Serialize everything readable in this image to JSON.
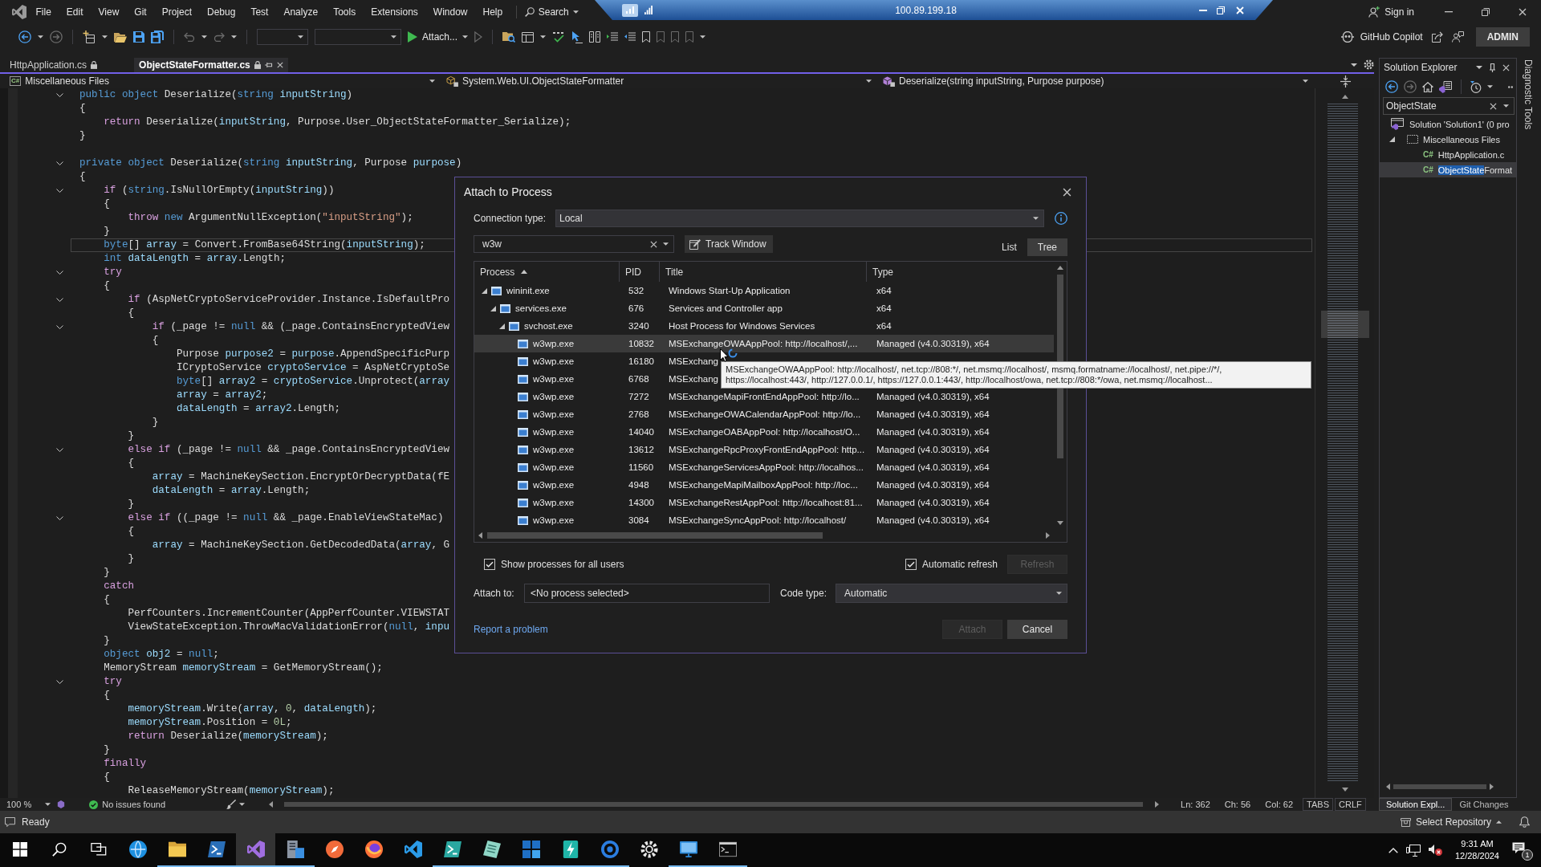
{
  "menu_bar": {
    "items": [
      "File",
      "Edit",
      "View",
      "Git",
      "Project",
      "Debug",
      "Test",
      "Analyze",
      "Tools",
      "Extensions",
      "Window",
      "Help"
    ],
    "search": "Search"
  },
  "remote_session": {
    "address": "100.89.199.18"
  },
  "account": {
    "sign_in": "Sign in"
  },
  "toolbar": {
    "attach": "Attach...",
    "copilot": "GitHub Copilot",
    "user": "ADMIN"
  },
  "tabs": [
    {
      "label": "HttpApplication.cs",
      "selected": false
    },
    {
      "label": "ObjectStateFormatter.cs",
      "selected": true
    }
  ],
  "nav_bar": [
    {
      "kind": "project",
      "badge": "C#",
      "label": "Miscellaneous Files"
    },
    {
      "kind": "class",
      "label": "System.Web.UI.ObjectStateFormatter"
    },
    {
      "kind": "method",
      "label": "Deserialize(string inputString, Purpose purpose)"
    }
  ],
  "code_lines": [
    {
      "spans": [
        {
          "kind": "keyword",
          "text": "public object"
        },
        {
          "kind": "plain",
          "text": " Deserialize("
        },
        {
          "kind": "keyword",
          "text": "string"
        },
        {
          "kind": "variable",
          "text": " inputString"
        },
        {
          "kind": "plain",
          "text": ")"
        }
      ],
      "fold": true,
      "current": false
    },
    {
      "spans": [
        {
          "kind": "plain",
          "text": "{"
        }
      ],
      "fold": false,
      "current": false
    },
    {
      "spans": [
        {
          "kind": "control",
          "text": "    return"
        },
        {
          "kind": "plain",
          "text": " Deserialize("
        },
        {
          "kind": "variable",
          "text": "inputString"
        },
        {
          "kind": "plain",
          "text": ", Purpose.User_ObjectStateFormatter_Serialize);"
        }
      ],
      "fold": false,
      "current": false
    },
    {
      "spans": [
        {
          "kind": "plain",
          "text": "}"
        }
      ],
      "fold": false,
      "current": false
    },
    {
      "fold": false,
      "current": false
    },
    {
      "spans": [
        {
          "kind": "keyword",
          "text": "private object"
        },
        {
          "kind": "plain",
          "text": " Deserialize("
        },
        {
          "kind": "keyword",
          "text": "string"
        },
        {
          "kind": "variable",
          "text": " inputString"
        },
        {
          "kind": "plain",
          "text": ", Purpose"
        },
        {
          "kind": "variable",
          "text": " purpose"
        },
        {
          "kind": "plain",
          "text": ")"
        }
      ],
      "fold": true,
      "current": false
    },
    {
      "spans": [
        {
          "kind": "plain",
          "text": "{"
        }
      ],
      "fold": false,
      "current": false
    },
    {
      "spans": [
        {
          "kind": "control",
          "text": "    if"
        },
        {
          "kind": "plain",
          "text": " ("
        },
        {
          "kind": "keyword",
          "text": "string"
        },
        {
          "kind": "plain",
          "text": ".IsNullOrEmpty("
        },
        {
          "kind": "variable",
          "text": "inputString"
        },
        {
          "kind": "plain",
          "text": "))"
        }
      ],
      "fold": true,
      "current": false
    },
    {
      "spans": [
        {
          "kind": "plain",
          "text": "    {"
        }
      ],
      "fold": false,
      "current": false
    },
    {
      "spans": [
        {
          "kind": "control",
          "text": "        throw"
        },
        {
          "kind": "keyword",
          "text": " new"
        },
        {
          "kind": "plain",
          "text": " ArgumentNullException("
        },
        {
          "kind": "string",
          "text": "\"inputString\""
        },
        {
          "kind": "plain",
          "text": ");"
        }
      ],
      "fold": false,
      "current": false
    },
    {
      "spans": [
        {
          "kind": "plain",
          "text": "    }"
        }
      ],
      "fold": false,
      "current": false
    },
    {
      "spans": [
        {
          "kind": "keyword",
          "text": "    byte"
        },
        {
          "kind": "plain",
          "text": "[]"
        },
        {
          "kind": "variable",
          "text": " array"
        },
        {
          "kind": "plain",
          "text": " = Convert.FromBase64String("
        },
        {
          "kind": "variable",
          "text": "inputString"
        },
        {
          "kind": "plain",
          "text": ");"
        }
      ],
      "fold": false,
      "current": true
    },
    {
      "spans": [
        {
          "kind": "keyword",
          "text": "    int"
        },
        {
          "kind": "variable",
          "text": " dataLength"
        },
        {
          "kind": "plain",
          "text": " ="
        },
        {
          "kind": "variable",
          "text": " array"
        },
        {
          "kind": "plain",
          "text": ".Length;"
        }
      ],
      "fold": false,
      "current": false
    },
    {
      "spans": [
        {
          "kind": "control",
          "text": "    try"
        }
      ],
      "fold": true,
      "current": false
    },
    {
      "spans": [
        {
          "kind": "plain",
          "text": "    {"
        }
      ],
      "fold": false,
      "current": false
    },
    {
      "spans": [
        {
          "kind": "control",
          "text": "        if"
        },
        {
          "kind": "plain",
          "text": " (AspNetCryptoServiceProvider.Instance.IsDefaultPro"
        }
      ],
      "fold": true,
      "current": false
    },
    {
      "spans": [
        {
          "kind": "plain",
          "text": "        {"
        }
      ],
      "fold": false,
      "current": false
    },
    {
      "spans": [
        {
          "kind": "control",
          "text": "            if"
        },
        {
          "kind": "plain",
          "text": " (_page !="
        },
        {
          "kind": "keyword",
          "text": " null"
        },
        {
          "kind": "plain",
          "text": " && (_page.ContainsEncryptedView"
        }
      ],
      "fold": true,
      "current": false
    },
    {
      "spans": [
        {
          "kind": "plain",
          "text": "            {"
        }
      ],
      "fold": false,
      "current": false
    },
    {
      "spans": [
        {
          "kind": "plain",
          "text": "                Purpose"
        },
        {
          "kind": "variable",
          "text": " purpose2"
        },
        {
          "kind": "plain",
          "text": " ="
        },
        {
          "kind": "variable",
          "text": " purpose"
        },
        {
          "kind": "plain",
          "text": ".AppendSpecificPurp"
        }
      ],
      "fold": false,
      "current": false
    },
    {
      "spans": [
        {
          "kind": "plain",
          "text": "                ICryptoService"
        },
        {
          "kind": "variable",
          "text": " cryptoService"
        },
        {
          "kind": "plain",
          "text": " = AspNetCryptoSe"
        }
      ],
      "fold": false,
      "current": false
    },
    {
      "spans": [
        {
          "kind": "keyword",
          "text": "                byte"
        },
        {
          "kind": "plain",
          "text": "[]"
        },
        {
          "kind": "variable",
          "text": " array2"
        },
        {
          "kind": "plain",
          "text": " ="
        },
        {
          "kind": "variable",
          "text": " cryptoService"
        },
        {
          "kind": "plain",
          "text": ".Unprotect("
        },
        {
          "kind": "variable",
          "text": "array"
        }
      ],
      "fold": false,
      "current": false
    },
    {
      "spans": [
        {
          "kind": "variable",
          "text": "                array"
        },
        {
          "kind": "plain",
          "text": " ="
        },
        {
          "kind": "variable",
          "text": " array2"
        },
        {
          "kind": "plain",
          "text": ";"
        }
      ],
      "fold": false,
      "current": false
    },
    {
      "spans": [
        {
          "kind": "variable",
          "text": "                dataLength"
        },
        {
          "kind": "plain",
          "text": " ="
        },
        {
          "kind": "variable",
          "text": " array2"
        },
        {
          "kind": "plain",
          "text": ".Length;"
        }
      ],
      "fold": false,
      "current": false
    },
    {
      "spans": [
        {
          "kind": "plain",
          "text": "            }"
        }
      ],
      "fold": false,
      "current": false
    },
    {
      "spans": [
        {
          "kind": "plain",
          "text": "        }"
        }
      ],
      "fold": false,
      "current": false
    },
    {
      "spans": [
        {
          "kind": "control",
          "text": "        else if"
        },
        {
          "kind": "plain",
          "text": " (_page !="
        },
        {
          "kind": "keyword",
          "text": " null"
        },
        {
          "kind": "plain",
          "text": " && _page.ContainsEncryptedView"
        }
      ],
      "fold": true,
      "current": false
    },
    {
      "spans": [
        {
          "kind": "plain",
          "text": "        {"
        }
      ],
      "fold": false,
      "current": false
    },
    {
      "spans": [
        {
          "kind": "variable",
          "text": "            array"
        },
        {
          "kind": "plain",
          "text": " = MachineKeySection.EncryptOrDecryptData(fE"
        }
      ],
      "fold": false,
      "current": false
    },
    {
      "spans": [
        {
          "kind": "variable",
          "text": "            dataLength"
        },
        {
          "kind": "plain",
          "text": " ="
        },
        {
          "kind": "variable",
          "text": " array"
        },
        {
          "kind": "plain",
          "text": ".Length;"
        }
      ],
      "fold": false,
      "current": false
    },
    {
      "spans": [
        {
          "kind": "plain",
          "text": "        }"
        }
      ],
      "fold": false,
      "current": false
    },
    {
      "spans": [
        {
          "kind": "control",
          "text": "        else if"
        },
        {
          "kind": "plain",
          "text": " ((_page !="
        },
        {
          "kind": "keyword",
          "text": " null"
        },
        {
          "kind": "plain",
          "text": " && _page.EnableViewStateMac)"
        }
      ],
      "fold": true,
      "current": false
    },
    {
      "spans": [
        {
          "kind": "plain",
          "text": "        {"
        }
      ],
      "fold": false,
      "current": false
    },
    {
      "spans": [
        {
          "kind": "variable",
          "text": "            array"
        },
        {
          "kind": "plain",
          "text": " = MachineKeySection.GetDecodedData("
        },
        {
          "kind": "variable",
          "text": "array"
        },
        {
          "kind": "plain",
          "text": ", G"
        }
      ],
      "fold": false,
      "current": false
    },
    {
      "spans": [
        {
          "kind": "plain",
          "text": "        }"
        }
      ],
      "fold": false,
      "current": false
    },
    {
      "spans": [
        {
          "kind": "plain",
          "text": "    }"
        }
      ],
      "fold": false,
      "current": false
    },
    {
      "spans": [
        {
          "kind": "control",
          "text": "    catch"
        }
      ],
      "fold": false,
      "current": false
    },
    {
      "spans": [
        {
          "kind": "plain",
          "text": "    {"
        }
      ],
      "fold": false,
      "current": false
    },
    {
      "spans": [
        {
          "kind": "plain",
          "text": "        PerfCounters.IncrementCounter(AppPerfCounter.VIEWSTAT"
        }
      ],
      "fold": false,
      "current": false
    },
    {
      "spans": [
        {
          "kind": "plain",
          "text": "        ViewStateException.ThrowMacValidationError("
        },
        {
          "kind": "keyword",
          "text": "null"
        },
        {
          "kind": "plain",
          "text": ","
        },
        {
          "kind": "variable",
          "text": " inpu"
        }
      ],
      "fold": false,
      "current": false
    },
    {
      "spans": [
        {
          "kind": "plain",
          "text": "    }"
        }
      ],
      "fold": false,
      "current": false
    },
    {
      "spans": [
        {
          "kind": "keyword",
          "text": "    object"
        },
        {
          "kind": "variable",
          "text": " obj2"
        },
        {
          "kind": "plain",
          "text": " ="
        },
        {
          "kind": "keyword",
          "text": " null"
        },
        {
          "kind": "plain",
          "text": ";"
        }
      ],
      "fold": false,
      "current": false
    },
    {
      "spans": [
        {
          "kind": "plain",
          "text": "    MemoryStream"
        },
        {
          "kind": "variable",
          "text": " memoryStream"
        },
        {
          "kind": "plain",
          "text": " = GetMemoryStream();"
        }
      ],
      "fold": false,
      "current": false
    },
    {
      "spans": [
        {
          "kind": "control",
          "text": "    try"
        }
      ],
      "fold": true,
      "current": false
    },
    {
      "spans": [
        {
          "kind": "plain",
          "text": "    {"
        }
      ],
      "fold": false,
      "current": false
    },
    {
      "spans": [
        {
          "kind": "variable",
          "text": "        memoryStream"
        },
        {
          "kind": "plain",
          "text": ".Write("
        },
        {
          "kind": "variable",
          "text": "array"
        },
        {
          "kind": "plain",
          "text": ","
        },
        {
          "kind": "number",
          "text": " 0"
        },
        {
          "kind": "plain",
          "text": ","
        },
        {
          "kind": "variable",
          "text": " dataLength"
        },
        {
          "kind": "plain",
          "text": ");"
        }
      ],
      "fold": false,
      "current": false
    },
    {
      "spans": [
        {
          "kind": "variable",
          "text": "        memoryStream"
        },
        {
          "kind": "plain",
          "text": ".Position ="
        },
        {
          "kind": "number",
          "text": " 0L"
        },
        {
          "kind": "plain",
          "text": ";"
        }
      ],
      "fold": false,
      "current": false
    },
    {
      "spans": [
        {
          "kind": "control",
          "text": "        return"
        },
        {
          "kind": "plain",
          "text": " Deserialize("
        },
        {
          "kind": "variable",
          "text": "memoryStream"
        },
        {
          "kind": "plain",
          "text": ");"
        }
      ],
      "fold": false,
      "current": false
    },
    {
      "spans": [
        {
          "kind": "plain",
          "text": "    }"
        }
      ],
      "fold": false,
      "current": false
    },
    {
      "spans": [
        {
          "kind": "control",
          "text": "    finally"
        }
      ],
      "fold": false,
      "current": false
    },
    {
      "spans": [
        {
          "kind": "plain",
          "text": "    {"
        }
      ],
      "fold": false,
      "current": false
    },
    {
      "spans": [
        {
          "kind": "plain",
          "text": "        ReleaseMemoryStream("
        },
        {
          "kind": "variable",
          "text": "memoryStream"
        },
        {
          "kind": "plain",
          "text": ");"
        }
      ],
      "fold": false,
      "current": false
    }
  ],
  "editor_status": {
    "zoom": "100 %",
    "issues": "No issues found",
    "line": "Ln: 362",
    "char": "Ch: 56",
    "column": "Col: 62",
    "indent": "TABS",
    "line_ending": "CRLF"
  },
  "dialog": {
    "title": "Attach to Process",
    "connection": {
      "label": "Connection type:",
      "value": "Local"
    },
    "filter": {
      "value": "w3w"
    },
    "track_button": "Track Window",
    "views": [
      {
        "label": "List",
        "selected": false
      },
      {
        "label": "Tree",
        "selected": true
      }
    ],
    "columns": [
      {
        "label": "Process",
        "sorted": true
      },
      {
        "label": "PID",
        "sorted": false
      },
      {
        "label": "Title",
        "sorted": false
      },
      {
        "label": "Type",
        "sorted": false
      }
    ],
    "rows": [
      {
        "process": "wininit.exe",
        "pid": "532",
        "title": "Windows Start-Up Application",
        "type": "x64",
        "expanded": true,
        "hovered": false,
        "children": [
          {
            "process": "services.exe",
            "pid": "676",
            "title": "Services and Controller app",
            "type": "x64",
            "expanded": true,
            "hovered": false,
            "children": [
              {
                "process": "svchost.exe",
                "pid": "3240",
                "title": "Host Process for Windows Services",
                "type": "x64",
                "expanded": true,
                "hovered": false,
                "children": [
                  {
                    "process": "w3wp.exe",
                    "pid": "10832",
                    "title": "MSExchangeOWAAppPool: http://localhost/,...",
                    "type": "Managed (v4.0.30319), x64",
                    "hovered": true
                  },
                  {
                    "process": "w3wp.exe",
                    "pid": "16180",
                    "title": "MSExchang",
                    "hovered": false
                  },
                  {
                    "process": "w3wp.exe",
                    "pid": "6768",
                    "title": "MSExchang",
                    "hovered": false
                  },
                  {
                    "process": "w3wp.exe",
                    "pid": "7272",
                    "title": "MSExchangeMapiFrontEndAppPool: http://lo...",
                    "type": "Managed (v4.0.30319), x64",
                    "hovered": false
                  },
                  {
                    "process": "w3wp.exe",
                    "pid": "2768",
                    "title": "MSExchangeOWACalendarAppPool: http://lo...",
                    "type": "Managed (v4.0.30319), x64",
                    "hovered": false
                  },
                  {
                    "process": "w3wp.exe",
                    "pid": "14040",
                    "title": "MSExchangeOABAppPool: http://localhost/O...",
                    "type": "Managed (v4.0.30319), x64",
                    "hovered": false
                  },
                  {
                    "process": "w3wp.exe",
                    "pid": "13612",
                    "title": "MSExchangeRpcProxyFrontEndAppPool: http...",
                    "type": "Managed (v4.0.30319), x64",
                    "hovered": false
                  },
                  {
                    "process": "w3wp.exe",
                    "pid": "11560",
                    "title": "MSExchangeServicesAppPool: http://localhos...",
                    "type": "Managed (v4.0.30319), x64",
                    "hovered": false
                  },
                  {
                    "process": "w3wp.exe",
                    "pid": "4948",
                    "title": "MSExchangeMapiMailboxAppPool: http://loc...",
                    "type": "Managed (v4.0.30319), x64",
                    "hovered": false
                  },
                  {
                    "process": "w3wp.exe",
                    "pid": "14300",
                    "title": "MSExchangeRestAppPool: http://localhost:81...",
                    "type": "Managed (v4.0.30319), x64",
                    "hovered": false
                  },
                  {
                    "process": "w3wp.exe",
                    "pid": "3084",
                    "title": "MSExchangeSyncAppPool: http://localhost/",
                    "type": "Managed (v4.0.30319), x64",
                    "hovered": false
                  }
                ]
              }
            ]
          }
        ]
      }
    ],
    "tooltip": "MSExchangeOWAAppPool: http://localhost/, net.tcp://808:*/, net.msmq://localhost/, msmq.formatname://localhost/, net.pipe://*/, https://localhost:443/, http://127.0.0.1/, https://127.0.0.1:443/, http://localhost/owa, net.tcp://808:*/owa, net.msmq://localhost...",
    "show_all_users": {
      "label": "Show processes for all users",
      "checked": true
    },
    "auto_refresh": {
      "label": "Automatic refresh",
      "checked": true
    },
    "refresh_button": {
      "label": "Refresh",
      "disabled": true
    },
    "attach_to": {
      "label": "Attach to:",
      "value": "<No process selected>"
    },
    "code_type": {
      "label": "Code type:",
      "value": "Automatic"
    },
    "report_link": "Report a problem",
    "buttons": [
      {
        "label": "Attach",
        "disabled": true
      },
      {
        "label": "Cancel",
        "disabled": false
      }
    ]
  },
  "solution_explorer": {
    "title": "Solution Explorer",
    "search": {
      "value": "ObjectState"
    },
    "tree": [
      {
        "kind": "solution",
        "label": "Solution 'Solution1' (0 pro",
        "selected": false,
        "children": [
          {
            "kind": "folder",
            "label": "Miscellaneous Files",
            "expanded": true,
            "selected": false,
            "children": [
              {
                "kind": "file",
                "badge": "C#",
                "label": "HttpApplication.c",
                "selected": false
              },
              {
                "kind": "file",
                "badge": "C#",
                "match": "ObjectState",
                "label": "Format",
                "selected": true
              }
            ]
          }
        ]
      }
    ]
  },
  "side_tab": "Diagnostic Tools",
  "panel_tabs": [
    {
      "label": "Solution Expl...",
      "selected": true
    },
    {
      "label": "Git Changes",
      "selected": false
    }
  ],
  "status_bar": {
    "state": "Ready",
    "repository": "Select Repository"
  },
  "taskbar": {
    "apps": [
      {
        "kind": "browser",
        "active": false,
        "running": false
      },
      {
        "kind": "folder",
        "active": false,
        "running": true
      },
      {
        "kind": "shell",
        "active": false,
        "running": true
      },
      {
        "kind": "studio",
        "active": true,
        "running": true
      },
      {
        "kind": "server",
        "active": false,
        "running": true
      },
      {
        "kind": "compass",
        "active": false,
        "running": false
      },
      {
        "kind": "fox",
        "active": false,
        "running": false
      },
      {
        "kind": "code",
        "active": false,
        "running": false
      },
      {
        "kind": "ise",
        "active": false,
        "running": true
      },
      {
        "kind": "pad",
        "active": false,
        "running": true
      },
      {
        "kind": "mail",
        "active": false,
        "running": true
      },
      {
        "kind": "bolt",
        "active": false,
        "running": true
      },
      {
        "kind": "ring",
        "active": false,
        "running": true
      },
      {
        "kind": "gear",
        "active": false,
        "running": false
      },
      {
        "kind": "remote",
        "active": false,
        "running": true
      },
      {
        "kind": "console",
        "active": false,
        "running": true
      }
    ],
    "time": "9:31 AM",
    "date": "12/28/2024",
    "notifications": "1"
  }
}
